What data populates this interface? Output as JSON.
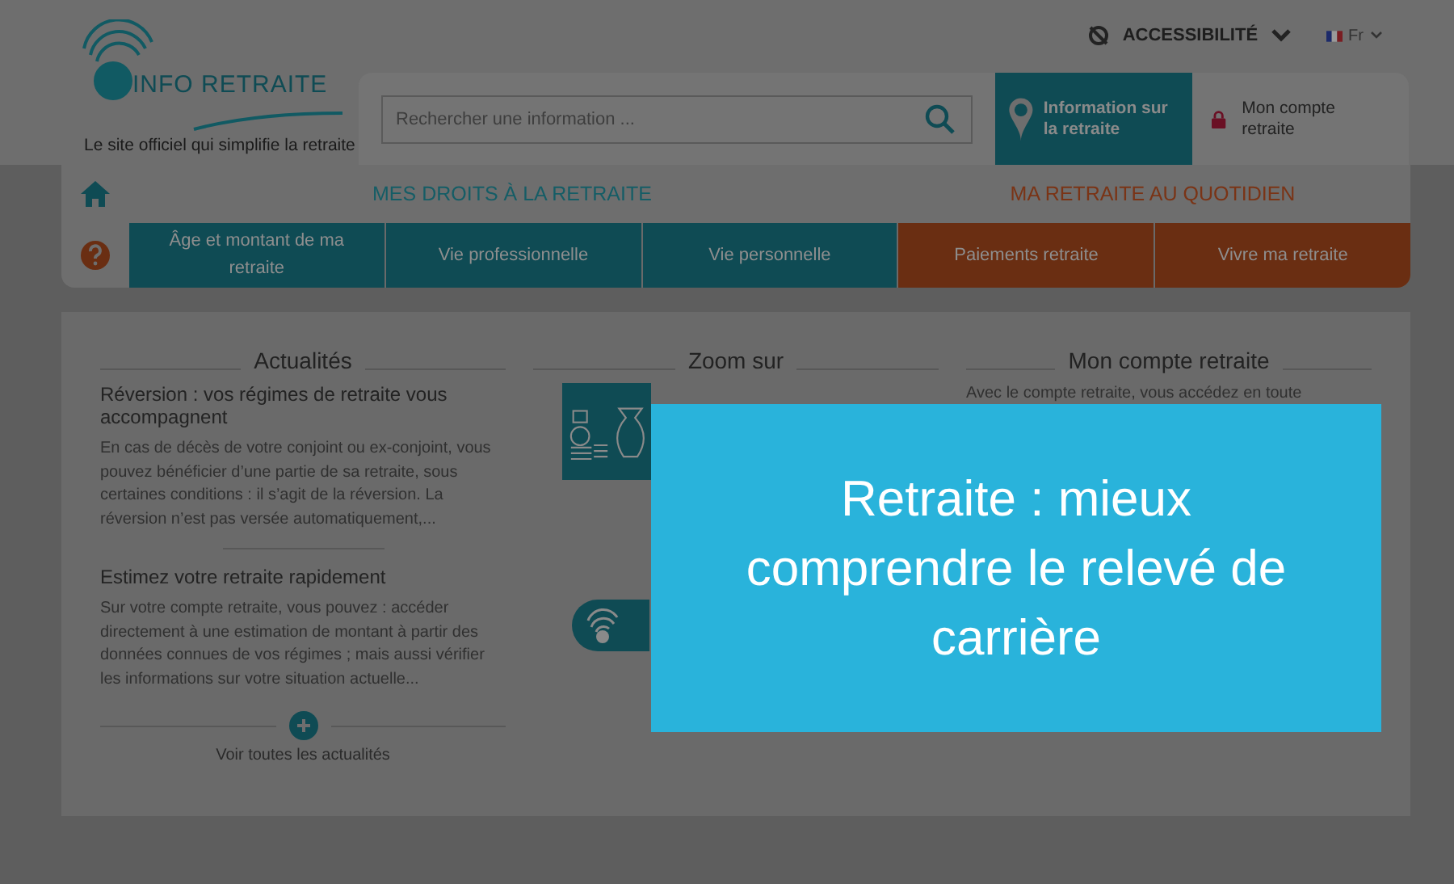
{
  "header": {
    "logo_text": "INFO RETRAITE",
    "tagline": "Le site officiel qui simplifie la retraite",
    "accessibility": "ACCESSIBILITÉ",
    "language": "Fr",
    "search": {
      "placeholder": "Rechercher une information ..."
    },
    "info_link": "Information sur la retraite",
    "account_link": "Mon compte retraite"
  },
  "nav": {
    "sections": [
      {
        "label": "MES DROITS À LA RETRAITE",
        "color": "#155d66"
      },
      {
        "label": "MA RETRAITE AU QUOTIDIEN",
        "color": "#7a3416"
      }
    ],
    "tabs": [
      {
        "label": "Âge et montant de ma retraite",
        "color": "#0f4b54"
      },
      {
        "label": "Vie professionnelle",
        "color": "#0f4b54"
      },
      {
        "label": "Vie personnelle",
        "color": "#0f4b54"
      },
      {
        "label": "Paiements retraite",
        "color": "#6a2e12"
      },
      {
        "label": "Vivre ma retraite",
        "color": "#6a2e12"
      }
    ]
  },
  "news": {
    "title": "Actualités",
    "items": [
      {
        "title": "Réversion : vos régimes de retraite vous accompagnent",
        "text": "En cas de décès de votre conjoint ou ex-conjoint, vous pouvez bénéficier d’une partie de sa retraite, sous certaines conditions : il s’agit de la réversion. La réversion n’est pas versée automatiquement,..."
      },
      {
        "title": "Estimez votre retraite rapidement",
        "text": "Sur votre compte retraite, vous pouvez : accéder directement à une estimation de montant à partir des données connues de vos régimes ; mais aussi vérifier les informations sur votre situation actuelle..."
      }
    ],
    "more": "Voir toutes les actualités"
  },
  "zoom": {
    "title": "Zoom sur"
  },
  "account": {
    "title": "Mon compte retraite",
    "text": "Avec le compte retraite, vous accédez en toute"
  },
  "article_title": "Retraite : mieux comprendre le relevé de carrière"
}
